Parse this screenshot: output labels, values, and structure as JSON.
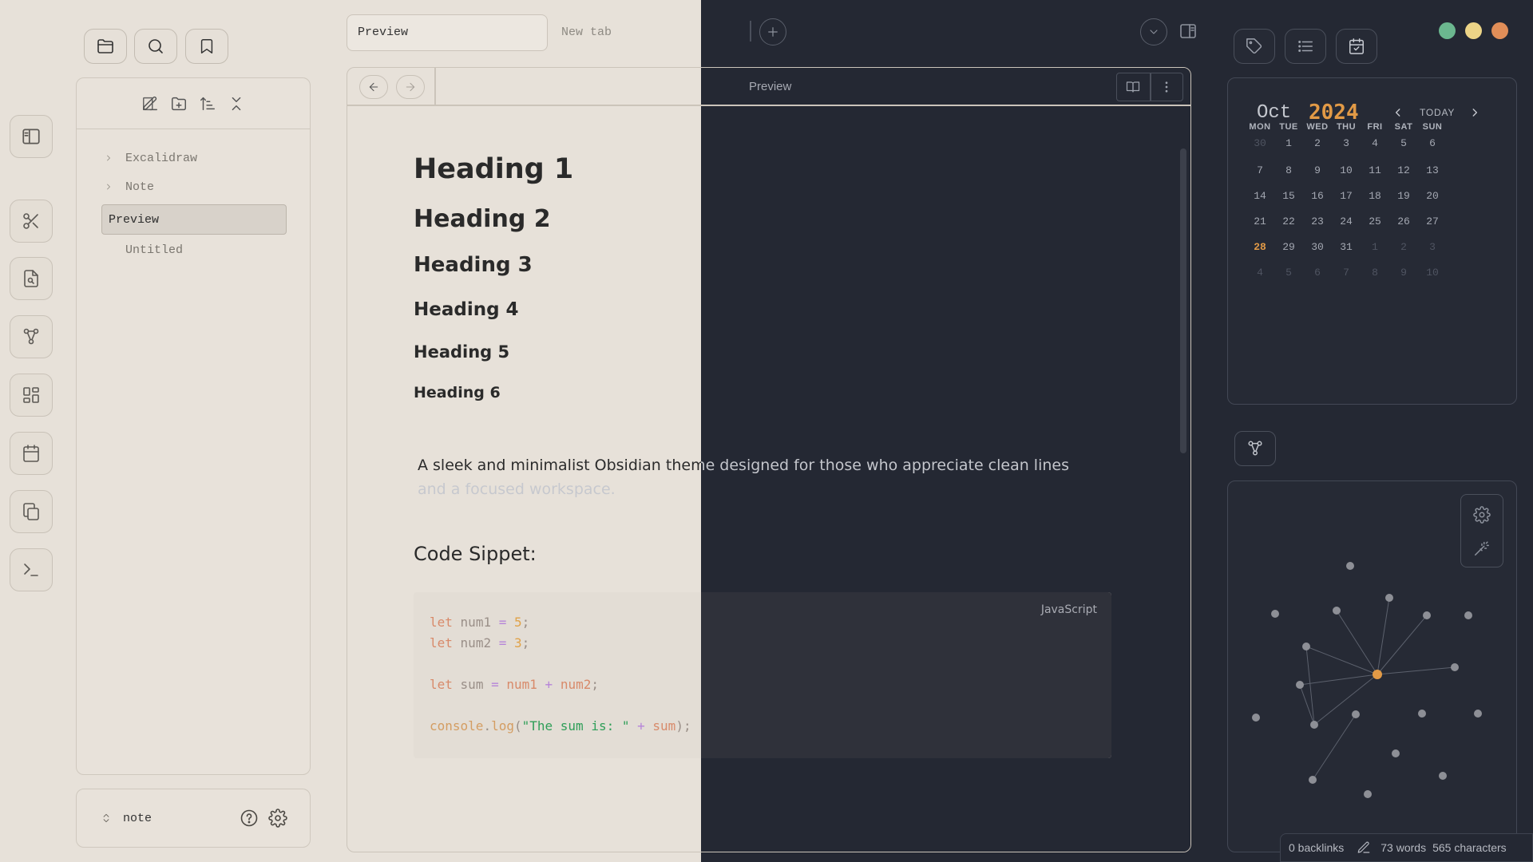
{
  "window": {
    "traffic_lights": [
      "#6bb78f",
      "#ecd487",
      "#e18e58"
    ]
  },
  "ribbon": {
    "items": [
      "sidebar-toggle",
      "scissors",
      "file-search",
      "graph",
      "dashboard",
      "calendar",
      "copy",
      "terminal"
    ]
  },
  "sidebar": {
    "top_icons": [
      "folder-icon",
      "search-icon",
      "bookmark-icon"
    ],
    "toolbar_icons": [
      "new-note-icon",
      "new-folder-icon",
      "sort-icon",
      "collapse-icon"
    ],
    "tree": [
      {
        "label": "Excalidraw",
        "type": "folder"
      },
      {
        "label": "Note",
        "type": "folder"
      },
      {
        "label": "Preview",
        "type": "file",
        "active": true
      },
      {
        "label": "Untitled",
        "type": "file"
      }
    ],
    "vault_name": "note"
  },
  "tabs": {
    "active": "Preview",
    "new": "New tab"
  },
  "editor": {
    "view_title": "Preview",
    "headings": [
      "Heading 1",
      "Heading 2",
      "Heading 3",
      "Heading 4",
      "Heading 5",
      "Heading 6"
    ],
    "paragraph": "A sleek and minimalist Obsidian theme designed for those who appreciate clean lines and a focused workspace.",
    "code_heading": "Code Sippet:",
    "code_lang": "JavaScript"
  },
  "calendar": {
    "month": "Oct",
    "year": "2024",
    "today_label": "TODAY",
    "weekdays": [
      "MON",
      "TUE",
      "WED",
      "THU",
      "FRI",
      "SAT",
      "SUN"
    ],
    "weeks": [
      [
        "30",
        "1",
        "2",
        "3",
        "4",
        "5",
        "6"
      ],
      [
        "7",
        "8",
        "9",
        "10",
        "11",
        "12",
        "13"
      ],
      [
        "14",
        "15",
        "16",
        "17",
        "18",
        "19",
        "20"
      ],
      [
        "21",
        "22",
        "23",
        "24",
        "25",
        "26",
        "27"
      ],
      [
        "28",
        "29",
        "30",
        "31",
        "1",
        "2",
        "3"
      ],
      [
        "4",
        "5",
        "6",
        "7",
        "8",
        "9",
        "10"
      ]
    ],
    "today": "28",
    "accent": "#e29a46"
  },
  "status": {
    "backlinks": "0 backlinks",
    "words": "73 words",
    "chars": "565 characters"
  }
}
